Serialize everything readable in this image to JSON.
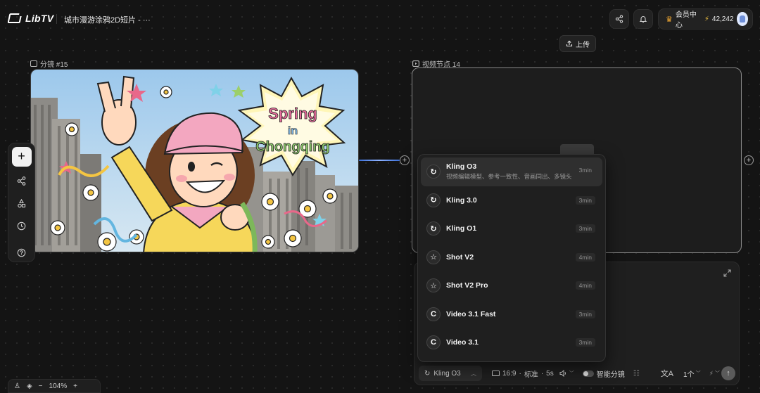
{
  "header": {
    "logo_text": "LibTV",
    "project_title": "城市漫游涂鸦2D短片 - ···",
    "member_label": "会员中心",
    "credits": "42,242",
    "upload_label": "上传"
  },
  "image_node": {
    "label": "分镜 #15",
    "banner_line1": "Spring",
    "banner_line2": "in",
    "banner_line3": "Chongqing"
  },
  "video_node": {
    "label": "视频节点 14"
  },
  "models": [
    {
      "name": "Kling O3",
      "desc": "视频编辑模型、参考一致性、音画同出、多镜头",
      "time": "3min",
      "icon": "spiral-icon"
    },
    {
      "name": "Kling 3.0",
      "desc": "",
      "time": "3min",
      "icon": "spiral-icon"
    },
    {
      "name": "Kling O1",
      "desc": "",
      "time": "3min",
      "icon": "spiral-icon"
    },
    {
      "name": "Shot V2",
      "desc": "",
      "time": "4min",
      "icon": "star-icon"
    },
    {
      "name": "Shot V2 Pro",
      "desc": "",
      "time": "4min",
      "icon": "star-icon"
    },
    {
      "name": "Video 3.1 Fast",
      "desc": "",
      "time": "3min",
      "icon": "google-icon"
    },
    {
      "name": "Video 3.1",
      "desc": "",
      "time": "3min",
      "icon": "google-icon"
    }
  ],
  "toolbar": {
    "selected_model": "Kling O3",
    "aspect": "16:9",
    "quality": "标准",
    "duration": "5s",
    "smart_shot": "智能分镜",
    "count": "1个"
  },
  "zoom": {
    "level": "104%"
  }
}
